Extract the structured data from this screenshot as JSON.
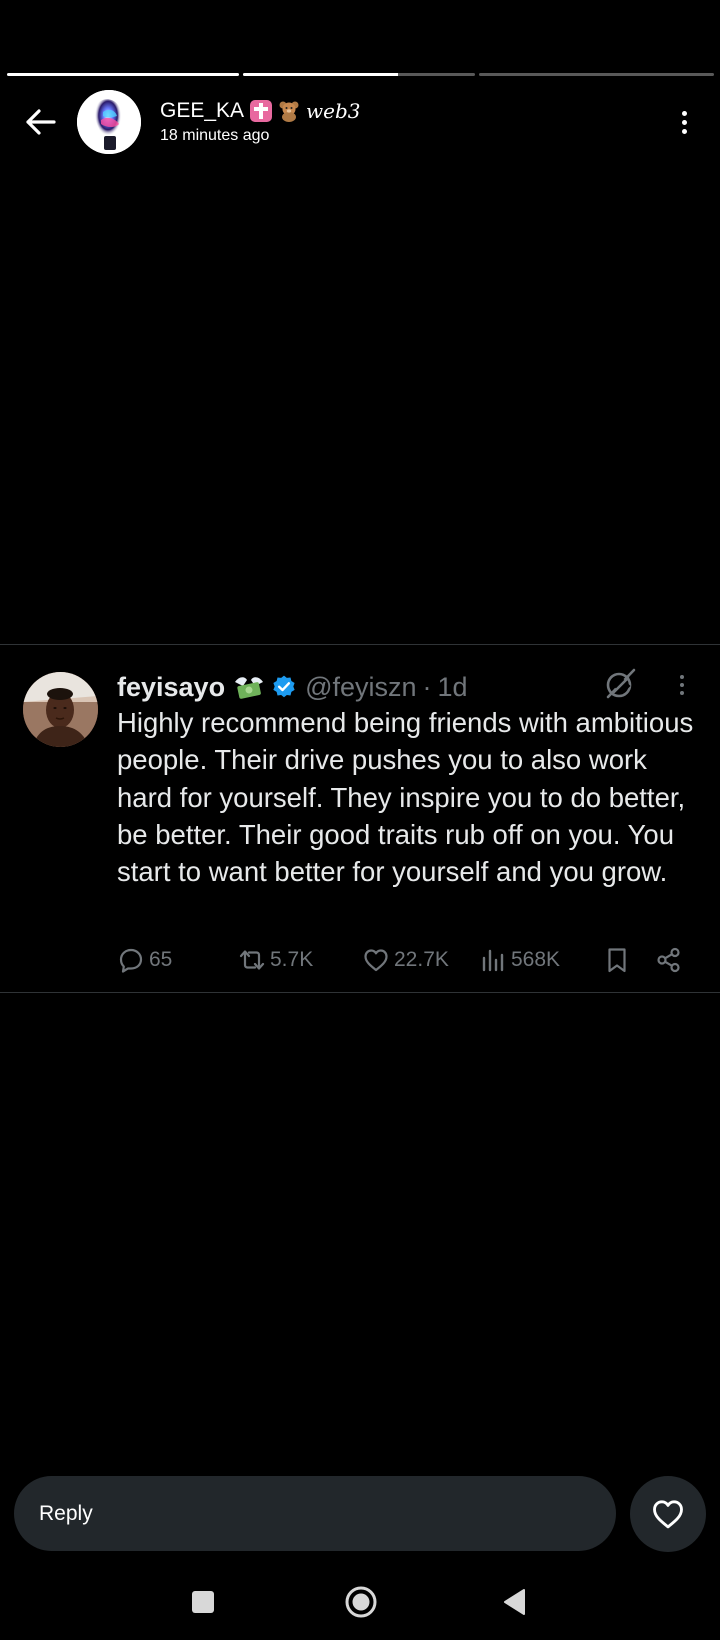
{
  "story": {
    "segments": [
      {
        "progress": 1.0
      },
      {
        "progress": 0.67
      },
      {
        "progress": 0.0
      }
    ],
    "author_name": "GEE_KA",
    "author_tag": "web3",
    "author_emojis": [
      "pink-cross-emoji",
      "teddy-bear-emoji"
    ],
    "posted_time": "18 minutes ago"
  },
  "tweet": {
    "author": "feyisayo",
    "author_emoji": "money-with-wings-emoji",
    "verified": true,
    "handle": "@feyiszn",
    "separator": "·",
    "age": "1d",
    "text": "Highly recommend being friends with ambitious people. Their drive pushes you to also work hard for yourself. They inspire you to do better, be better. Their good traits rub off on you. You start to want better for yourself and you grow.",
    "stats": {
      "replies": "65",
      "reposts": "5.7K",
      "likes": "22.7K",
      "views": "568K"
    }
  },
  "reply_bar": {
    "placeholder": "Reply"
  },
  "colors": {
    "background": "#000000",
    "muted": "#71767b",
    "text": "#e7e9ea",
    "verified": "#1d9bf0",
    "input_bg": "#22272b"
  }
}
